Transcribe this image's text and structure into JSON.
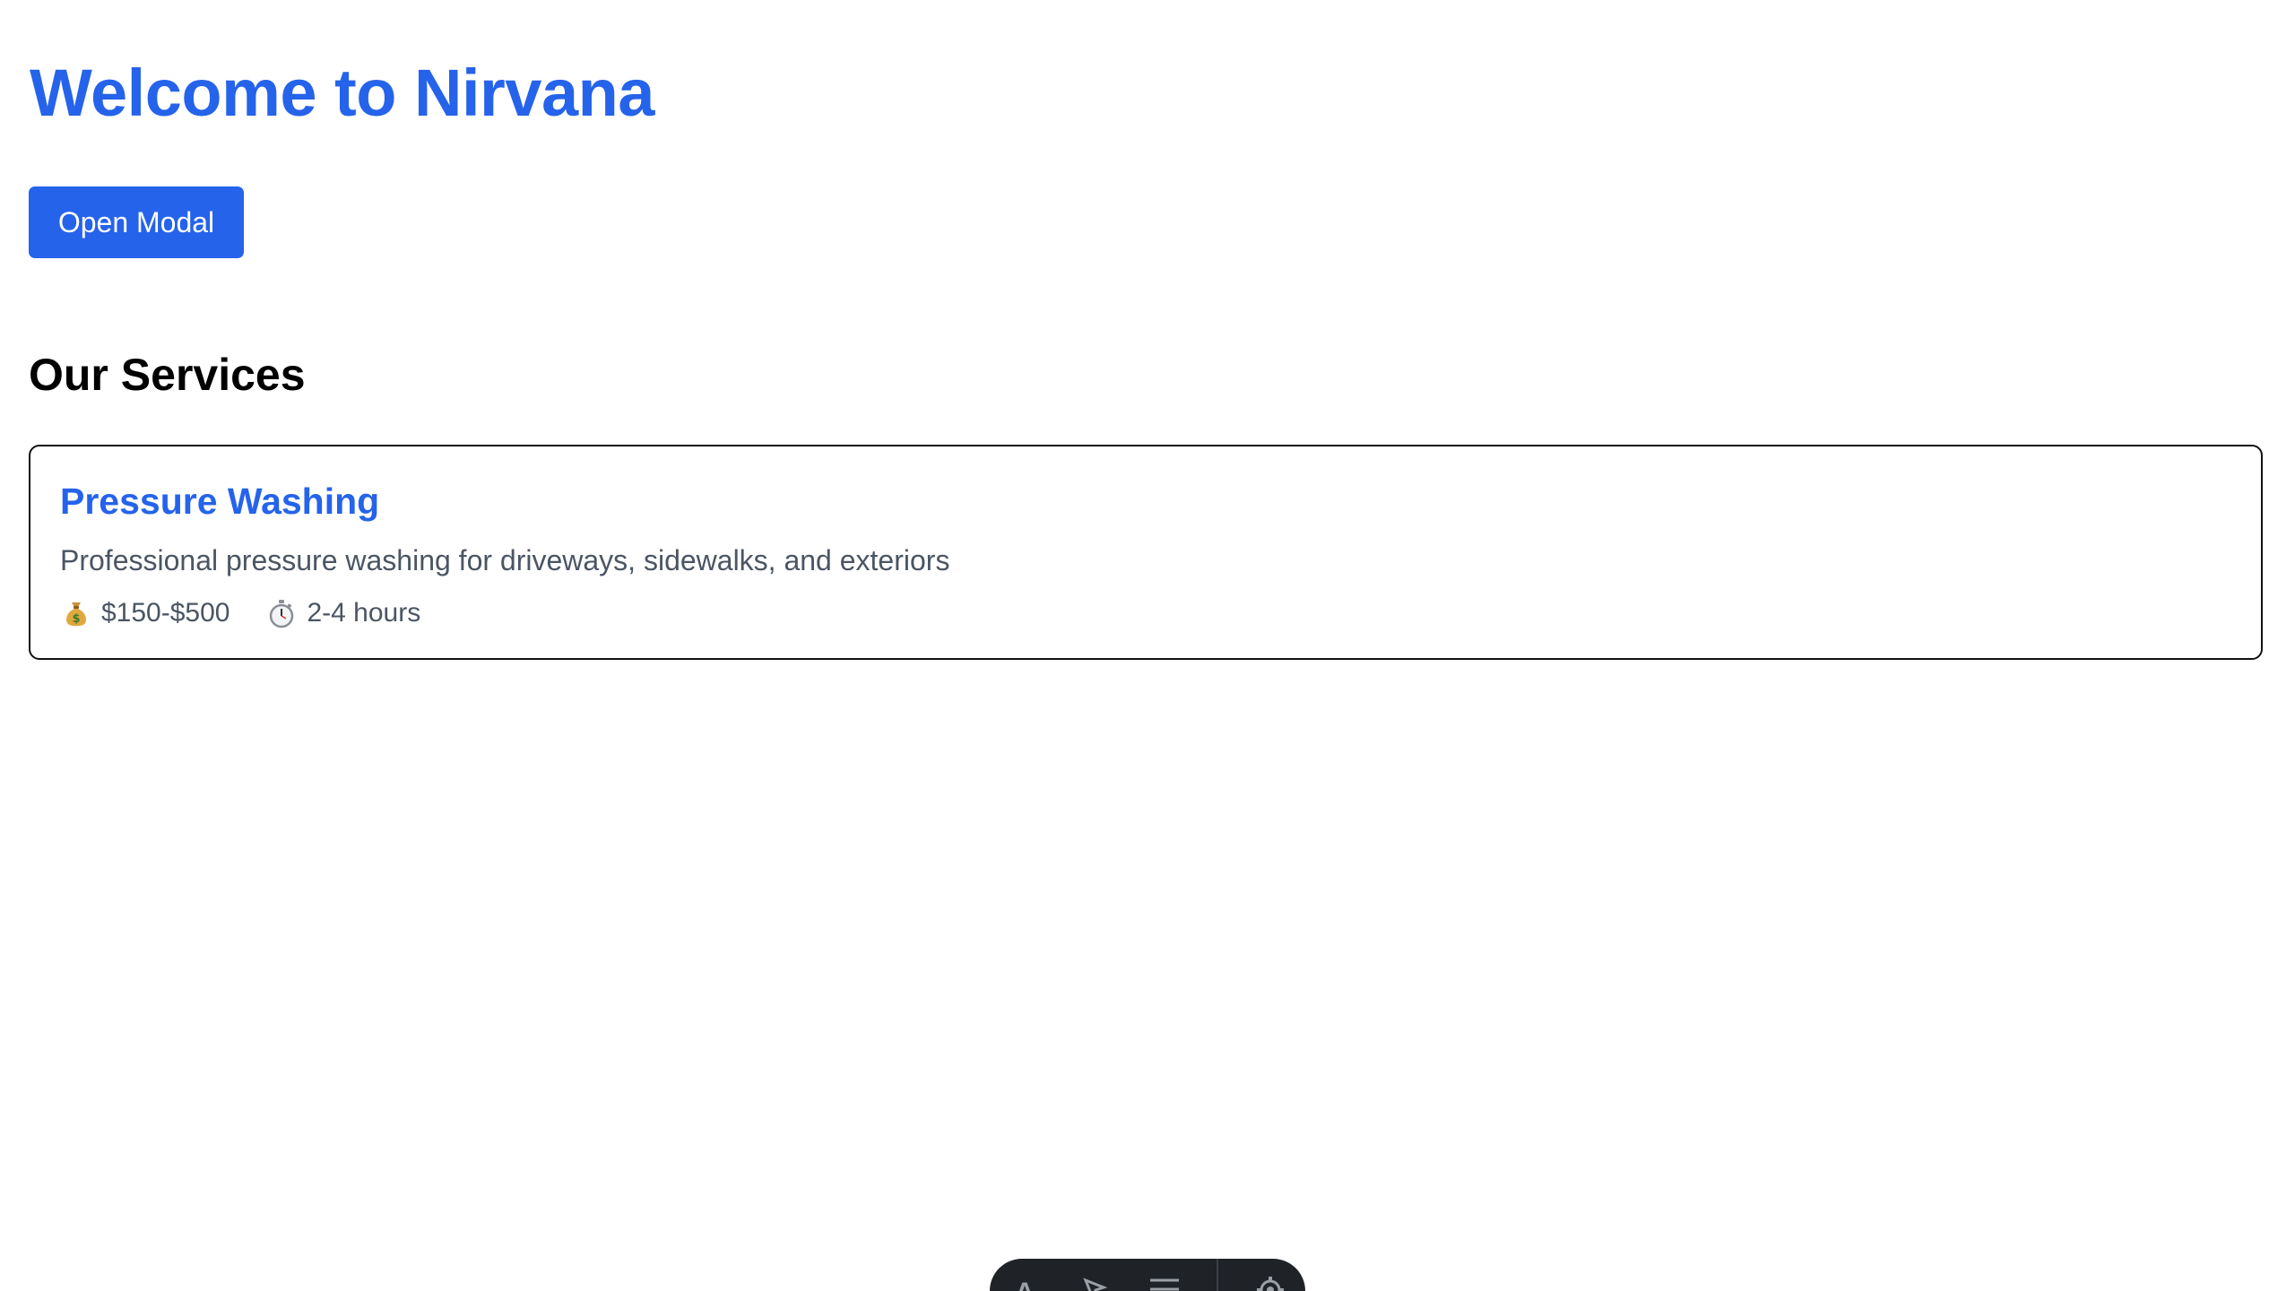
{
  "header": {
    "title": "Welcome to Nirvana"
  },
  "actions": {
    "open_modal_label": "Open Modal"
  },
  "services_section": {
    "title": "Our Services",
    "items": [
      {
        "name": "Pressure Washing",
        "description": "Professional pressure washing for driveways, sidewalks, and exteriors",
        "price_icon": "money-bag-icon",
        "price": "$150-$500",
        "duration_icon": "stopwatch-icon",
        "duration": "2-4 hours"
      }
    ]
  },
  "toolbar": {
    "tools": [
      {
        "icon": "text-tool-icon",
        "glyph": "A"
      },
      {
        "icon": "pointer-tool-icon"
      },
      {
        "icon": "menu-tool-icon"
      },
      {
        "icon": "settings-tool-icon"
      }
    ]
  },
  "colors": {
    "accent": "#2563eb",
    "text_muted": "#4b5563",
    "toolbar_bg": "#1f2328"
  }
}
